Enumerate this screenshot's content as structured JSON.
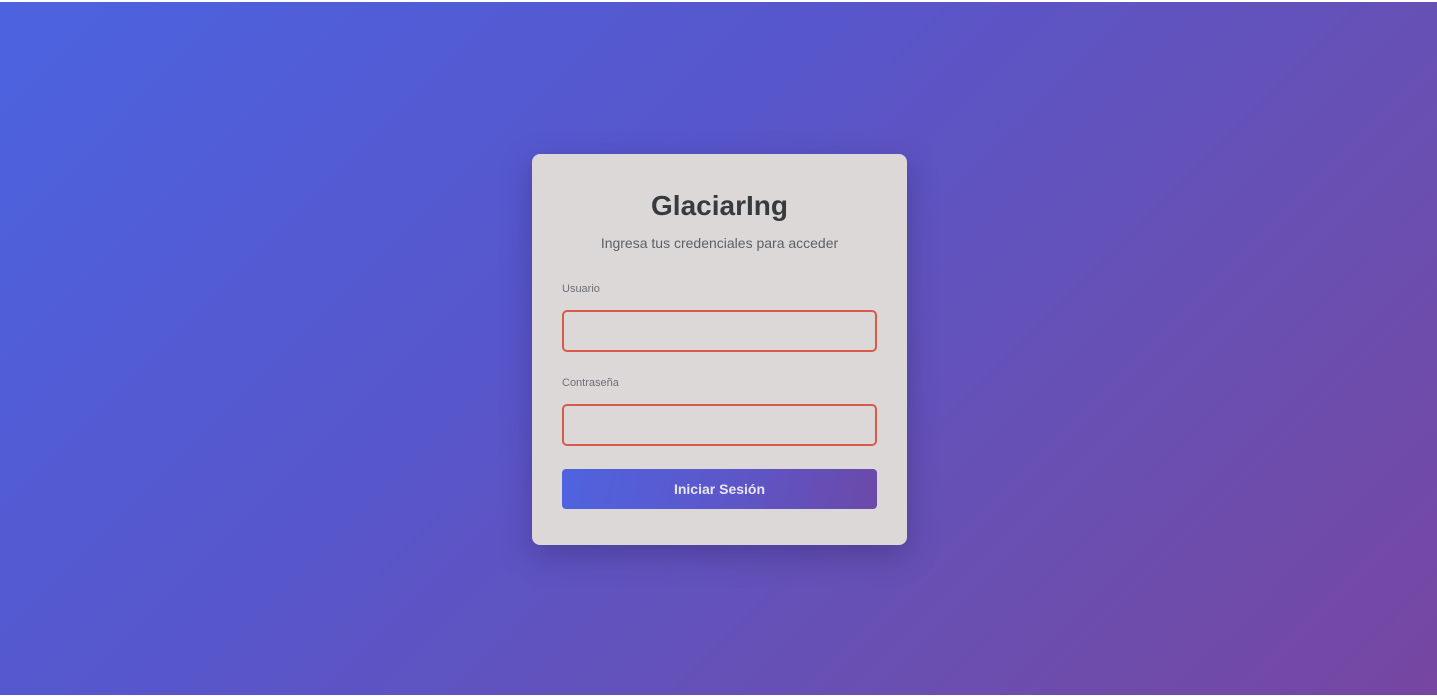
{
  "login": {
    "title": "GlaciarIng",
    "subtitle": "Ingresa tus credenciales para acceder",
    "username": {
      "label": "Usuario",
      "value": "",
      "placeholder": ""
    },
    "password": {
      "label": "Contraseña",
      "value": "",
      "placeholder": ""
    },
    "submit_label": "Iniciar Sesión"
  },
  "colors": {
    "background_start": "#4b63e0",
    "background_end": "#7646a2",
    "card_background": "#dcd8d8",
    "input_border_error": "#d85a4b",
    "title_text": "#363b3f"
  }
}
